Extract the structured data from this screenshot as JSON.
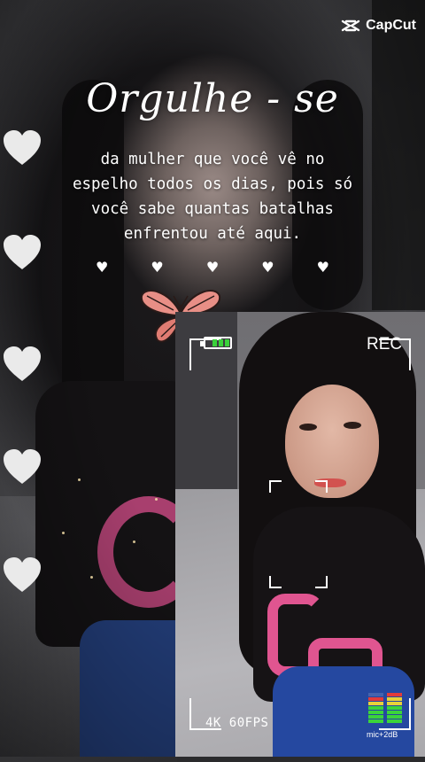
{
  "watermark": {
    "brand": "CapCut",
    "icon": "capcut-logo-icon"
  },
  "quote": {
    "title": "Orgulhe - se",
    "lines": [
      "da mulher que você vê no",
      "espelho todos os dias, pois só",
      "você sabe quantas batalhas",
      "enfrentou até aqui."
    ]
  },
  "decor": {
    "small_hearts": [
      "♥",
      "♥",
      "♥",
      "♥",
      "♥"
    ],
    "hearts_column_count": 5,
    "butterfly_icon": "butterfly-icon"
  },
  "camera": {
    "rec_label": "REC",
    "spec_label": "4K  60FPS",
    "mic_label": "mic+2dB",
    "battery_level": 0.75,
    "colors": {
      "battery": "#3ad13a",
      "meter_green": "#3bd43b",
      "meter_yellow": "#e8d23a",
      "meter_red": "#e23b3b"
    }
  }
}
